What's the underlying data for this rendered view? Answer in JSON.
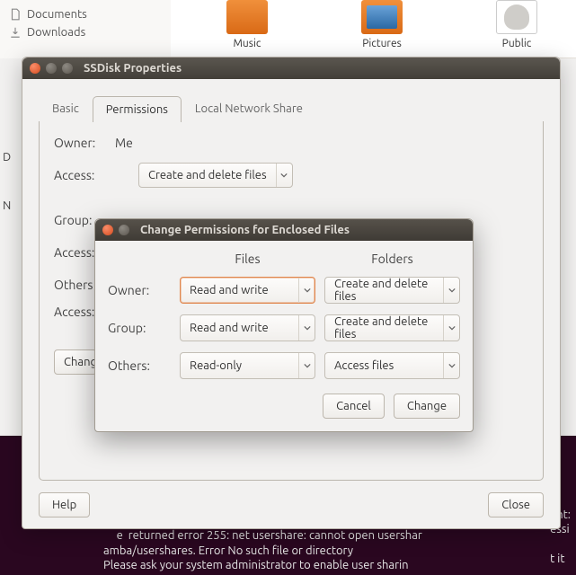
{
  "bg": {
    "sidebar": [
      {
        "icon": "document-icon",
        "label": "Documents"
      },
      {
        "icon": "download-icon",
        "label": "Downloads"
      }
    ],
    "icons": [
      {
        "kind": "music",
        "label": "Music"
      },
      {
        "kind": "pics",
        "label": "Pictures"
      },
      {
        "kind": "pub",
        "label": "Public"
      }
    ],
    "leftletters": [
      "D",
      "N"
    ]
  },
  "props": {
    "title": "SSDisk Properties",
    "tabs": {
      "basic": "Basic",
      "perm": "Permissions",
      "share": "Local Network Share"
    },
    "owner_label": "Owner:",
    "owner_value": "Me",
    "access_label": "Access:",
    "owner_access": "Create and delete files",
    "group_label": "Group:",
    "others_label": "Others",
    "change_btn": "Change",
    "help": "Help",
    "close": "Close"
  },
  "dlg": {
    "title": "Change Permissions for Enclosed Files",
    "headers": {
      "files": "Files",
      "folders": "Folders"
    },
    "rows": {
      "owner": {
        "label": "Owner:",
        "files": "Read and write",
        "folders": "Create and delete files"
      },
      "group": {
        "label": "Group:",
        "files": "Read and write",
        "folders": "Create and delete files"
      },
      "others": {
        "label": "Others:",
        "files": "Read-only",
        "folders": "Access files"
      }
    },
    "cancel": "Cancel",
    "change": "Change"
  },
  "term": {
    "lines": "e  returned error 255: net usershare: cannot open usershar\namba/usershares. Error No such file or directory\nPlease ask your system administrator to enable user sharin",
    "right": "ent:\nessi\n\nt it"
  }
}
